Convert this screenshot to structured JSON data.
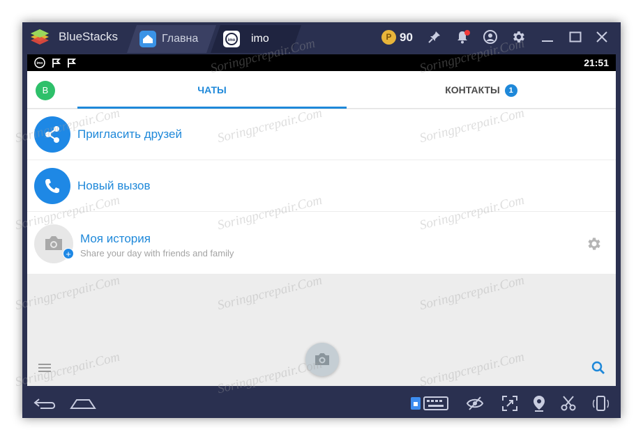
{
  "window": {
    "app_title": "BlueStacks",
    "tabs": [
      {
        "label": "Главна",
        "icon": "home-icon",
        "active": false
      },
      {
        "label": "imo",
        "icon": "imo-icon",
        "active": true
      }
    ],
    "coins": "90",
    "coin_symbol": "P",
    "toolbar_icons": [
      "pin-icon",
      "bell-icon",
      "account-icon",
      "gear-icon",
      "minimize-icon",
      "maximize-icon",
      "close-icon"
    ]
  },
  "statusbar": {
    "time": "21:51",
    "icons": [
      "imo-notification-icon",
      "flag-icon",
      "flag-icon"
    ]
  },
  "app": {
    "avatar_letter": "B",
    "tabs": {
      "chats": "ЧАТЫ",
      "contacts": "КОНТАКТЫ",
      "contacts_badge": "1"
    },
    "rows": {
      "invite": "Пригласить друзей",
      "new_call": "Новый вызов",
      "story_title": "Моя история",
      "story_subtitle": "Share your day with friends and family"
    }
  },
  "navbar": {
    "icons": [
      "back-icon",
      "home-icon",
      "keyboard-icon",
      "eye-icon",
      "fullscreen-icon",
      "location-icon",
      "scissors-icon",
      "rotate-icon"
    ]
  },
  "watermark": "Soringpcrepair.Com",
  "colors": {
    "accent": "#1e88d9",
    "chrome": "#2a3050",
    "avatar": "#2ec06a"
  }
}
